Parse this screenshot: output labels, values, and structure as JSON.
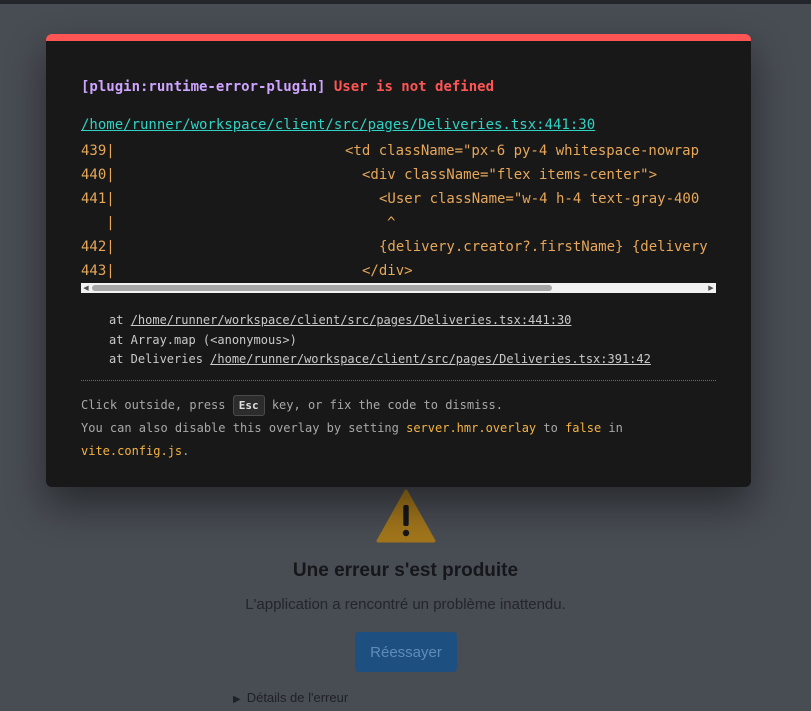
{
  "background": {
    "title": "Une erreur s'est produite",
    "subtitle": "L'application a rencontré un problème inattendu.",
    "retry_label": "Réessayer",
    "details_label": "Détails de l'erreur",
    "warning_icon": "warning-triangle-icon"
  },
  "overlay": {
    "plugin": "[plugin:runtime-error-plugin]",
    "message": "User is not defined",
    "file": "/home/runner/workspace/client/src/pages/Deliveries.tsx:441:30",
    "code_lines": [
      {
        "num": "439|",
        "code": "<td className=\"px-6 py-4 whitespace-nowrap"
      },
      {
        "num": "440|",
        "code": "<div className=\"flex items-center\">"
      },
      {
        "num": "441|",
        "code": "<User className=\"w-4 h-4 text-gray-400"
      },
      {
        "num": "   |",
        "code": "^"
      },
      {
        "num": "442|",
        "code": "{delivery.creator?.firstName} {delivery"
      },
      {
        "num": "443|",
        "code": "</div>"
      }
    ],
    "stack": {
      "l1_prefix": "at ",
      "l1_link": "/home/runner/workspace/client/src/pages/Deliveries.tsx:441:30",
      "l2": "at Array.map (<anonymous>)",
      "l3_prefix": "at Deliveries ",
      "l3_link": "/home/runner/workspace/client/src/pages/Deliveries.tsx:391:42"
    },
    "tip": {
      "t1": "Click outside, press ",
      "key": "Esc",
      "t2": " key, or fix the code to dismiss.",
      "t3": "You can also disable this overlay by setting ",
      "setting": "server.hmr.overlay",
      "t4": " to ",
      "value": "false",
      "t5": " in",
      "config": "vite.config.js",
      "t6": "."
    }
  },
  "colors": {
    "error_red": "#ff5555",
    "plugin_purple": "#cfa4ff",
    "link_cyan": "#2fd3c4",
    "code_orange": "#e6a75a",
    "highlight_yellow": "#f4b342"
  }
}
